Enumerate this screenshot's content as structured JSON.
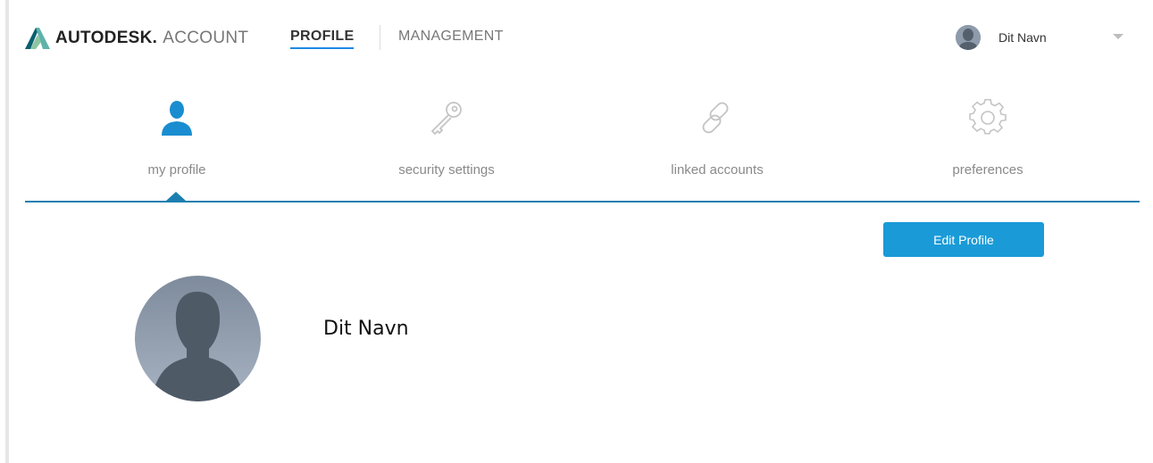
{
  "header": {
    "brand": "AUTODESK.",
    "brand_suffix": "ACCOUNT",
    "nav": [
      {
        "label": "PROFILE",
        "active": true
      },
      {
        "label": "MANAGEMENT",
        "active": false
      }
    ],
    "user_name": "Dit Navn"
  },
  "tabs": [
    {
      "label": "my profile",
      "icon": "user-icon",
      "active": true
    },
    {
      "label": "security settings",
      "icon": "key-icon",
      "active": false
    },
    {
      "label": "linked accounts",
      "icon": "link-icon",
      "active": false
    },
    {
      "label": "preferences",
      "icon": "gear-icon",
      "active": false
    }
  ],
  "main": {
    "edit_button_label": "Edit Profile",
    "profile_name": "Dit Navn"
  },
  "colors": {
    "accent": "#1a9bd7",
    "active_icon": "#1a8dd0",
    "tab_line": "#1a7fb0",
    "inactive_icon": "#c4c4c4"
  }
}
